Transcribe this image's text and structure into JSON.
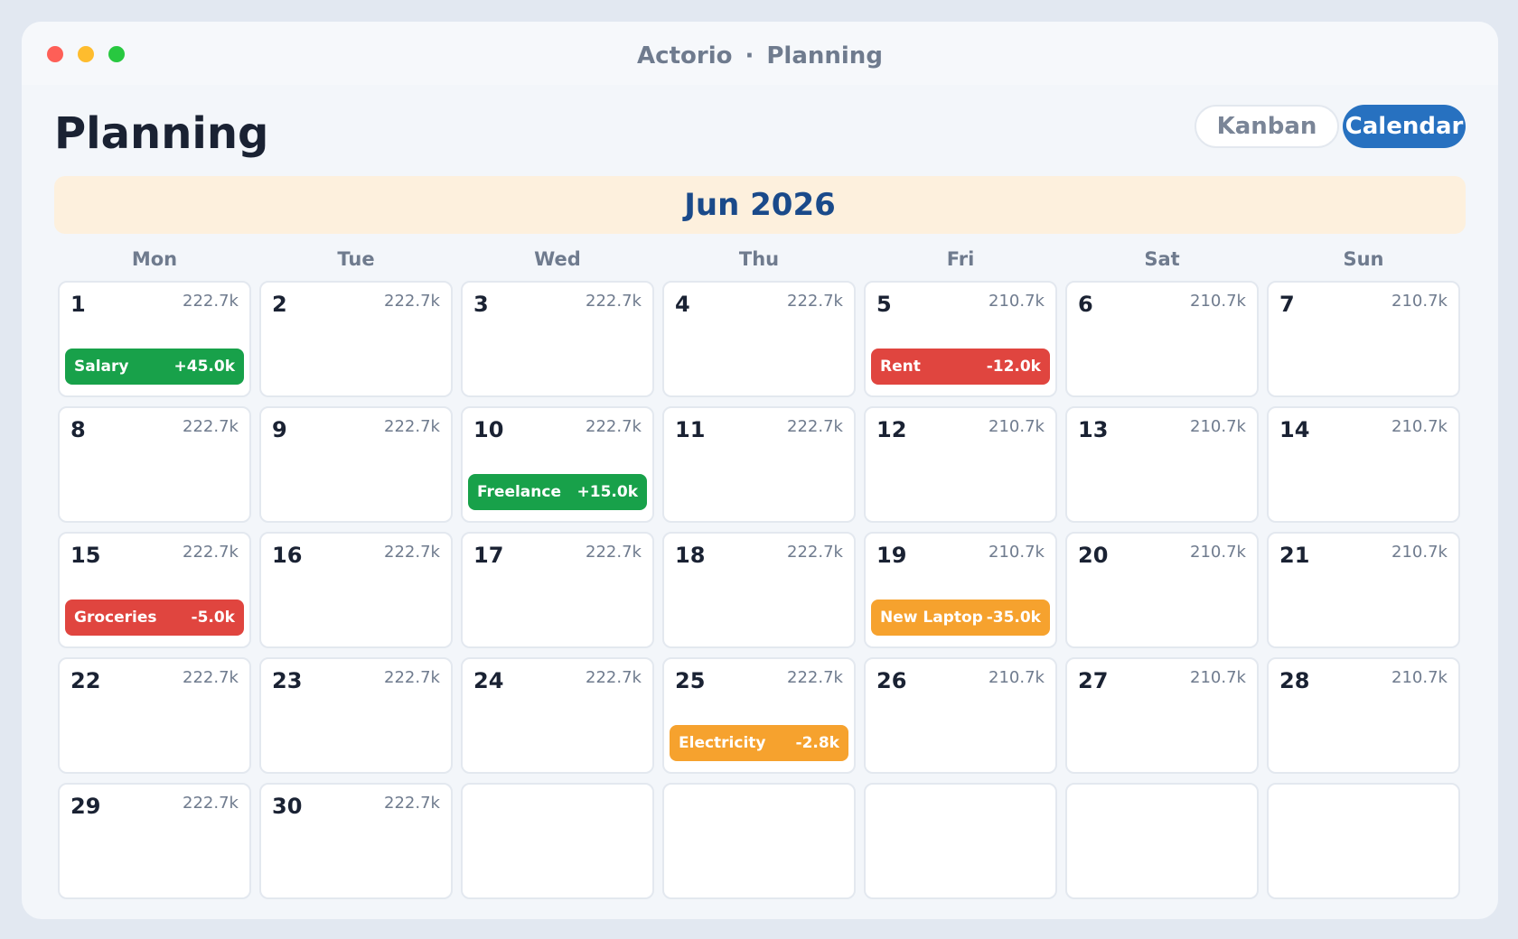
{
  "window": {
    "app_name": "Actorio",
    "separator": "·",
    "section": "Planning"
  },
  "page": {
    "title": "Planning"
  },
  "view_toggle": {
    "options": [
      "Kanban",
      "Calendar"
    ],
    "selected": "Calendar"
  },
  "calendar": {
    "month_label": "Jun 2026",
    "weekdays": [
      "Mon",
      "Tue",
      "Wed",
      "Thu",
      "Fri",
      "Sat",
      "Sun"
    ],
    "days": [
      {
        "day": "1",
        "balance": "222.7k",
        "event": {
          "label": "Salary",
          "amount": "+45.0k",
          "kind": "income"
        }
      },
      {
        "day": "2",
        "balance": "222.7k"
      },
      {
        "day": "3",
        "balance": "222.7k"
      },
      {
        "day": "4",
        "balance": "222.7k"
      },
      {
        "day": "5",
        "balance": "210.7k",
        "event": {
          "label": "Rent",
          "amount": "-12.0k",
          "kind": "expense"
        }
      },
      {
        "day": "6",
        "balance": "210.7k"
      },
      {
        "day": "7",
        "balance": "210.7k"
      },
      {
        "day": "8",
        "balance": "222.7k"
      },
      {
        "day": "9",
        "balance": "222.7k"
      },
      {
        "day": "10",
        "balance": "222.7k",
        "event": {
          "label": "Freelance",
          "amount": "+15.0k",
          "kind": "income"
        }
      },
      {
        "day": "11",
        "balance": "222.7k"
      },
      {
        "day": "12",
        "balance": "210.7k"
      },
      {
        "day": "13",
        "balance": "210.7k"
      },
      {
        "day": "14",
        "balance": "210.7k"
      },
      {
        "day": "15",
        "balance": "222.7k",
        "event": {
          "label": "Groceries",
          "amount": "-5.0k",
          "kind": "expense"
        }
      },
      {
        "day": "16",
        "balance": "222.7k"
      },
      {
        "day": "17",
        "balance": "222.7k"
      },
      {
        "day": "18",
        "balance": "222.7k"
      },
      {
        "day": "19",
        "balance": "210.7k",
        "event": {
          "label": "New Laptop",
          "amount": "-35.0k",
          "kind": "planned"
        }
      },
      {
        "day": "20",
        "balance": "210.7k"
      },
      {
        "day": "21",
        "balance": "210.7k"
      },
      {
        "day": "22",
        "balance": "222.7k"
      },
      {
        "day": "23",
        "balance": "222.7k"
      },
      {
        "day": "24",
        "balance": "222.7k"
      },
      {
        "day": "25",
        "balance": "222.7k",
        "event": {
          "label": "Electricity",
          "amount": "-2.8k",
          "kind": "planned"
        }
      },
      {
        "day": "26",
        "balance": "210.7k"
      },
      {
        "day": "27",
        "balance": "210.7k"
      },
      {
        "day": "28",
        "balance": "210.7k"
      },
      {
        "day": "29",
        "balance": "222.7k"
      },
      {
        "day": "30",
        "balance": "222.7k"
      },
      {
        "day": "",
        "balance": ""
      },
      {
        "day": "",
        "balance": ""
      },
      {
        "day": "",
        "balance": ""
      },
      {
        "day": "",
        "balance": ""
      },
      {
        "day": "",
        "balance": ""
      }
    ]
  },
  "colors": {
    "income": "#18a14a",
    "expense": "#e0453f",
    "planned": "#f6a22e",
    "accent": "#2771c0",
    "month_banner": "#fdf0dd",
    "window_controls": [
      "#fe5f57",
      "#febc2e",
      "#28c840"
    ]
  }
}
